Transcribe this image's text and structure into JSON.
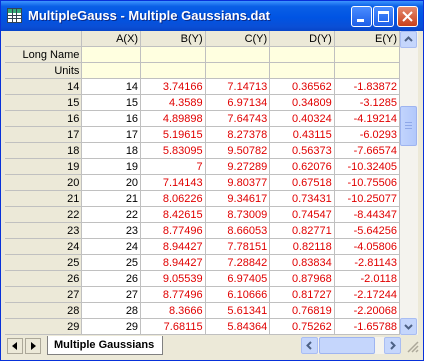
{
  "window": {
    "title": "MultipleGauss - Multiple Gaussians.dat"
  },
  "columns": [
    "A(X)",
    "B(Y)",
    "C(Y)",
    "D(Y)",
    "E(Y)"
  ],
  "meta_rows": [
    {
      "label": "Long Name",
      "values": [
        "",
        "",
        "",
        "",
        ""
      ]
    },
    {
      "label": "Units",
      "values": [
        "",
        "",
        "",
        "",
        ""
      ]
    }
  ],
  "rows": [
    {
      "label": "14",
      "values": [
        "14",
        "3.74166",
        "7.14713",
        "0.36562",
        "-1.83872"
      ]
    },
    {
      "label": "15",
      "values": [
        "15",
        "4.3589",
        "6.97134",
        "0.34809",
        "-3.1285"
      ]
    },
    {
      "label": "16",
      "values": [
        "16",
        "4.89898",
        "7.64743",
        "0.40324",
        "-4.19214"
      ]
    },
    {
      "label": "17",
      "values": [
        "17",
        "5.19615",
        "8.27378",
        "0.43115",
        "-6.0293"
      ]
    },
    {
      "label": "18",
      "values": [
        "18",
        "5.83095",
        "9.50782",
        "0.56373",
        "-7.66574"
      ]
    },
    {
      "label": "19",
      "values": [
        "19",
        "7",
        "9.27289",
        "0.62076",
        "-10.32405"
      ]
    },
    {
      "label": "20",
      "values": [
        "20",
        "7.14143",
        "9.80377",
        "0.67518",
        "-10.75506"
      ]
    },
    {
      "label": "21",
      "values": [
        "21",
        "8.06226",
        "9.34617",
        "0.73431",
        "-10.25077"
      ]
    },
    {
      "label": "22",
      "values": [
        "22",
        "8.42615",
        "8.73009",
        "0.74547",
        "-8.44347"
      ]
    },
    {
      "label": "23",
      "values": [
        "23",
        "8.77496",
        "8.66053",
        "0.82771",
        "-5.64256"
      ]
    },
    {
      "label": "24",
      "values": [
        "24",
        "8.94427",
        "7.78151",
        "0.82118",
        "-4.05806"
      ]
    },
    {
      "label": "25",
      "values": [
        "25",
        "8.94427",
        "7.28842",
        "0.83834",
        "-2.81143"
      ]
    },
    {
      "label": "26",
      "values": [
        "26",
        "9.05539",
        "6.97405",
        "0.87968",
        "-2.0118"
      ]
    },
    {
      "label": "27",
      "values": [
        "27",
        "8.77496",
        "6.10666",
        "0.81727",
        "-2.17244"
      ]
    },
    {
      "label": "28",
      "values": [
        "28",
        "8.3666",
        "5.61341",
        "0.76819",
        "-2.20068"
      ]
    },
    {
      "label": "29",
      "values": [
        "29",
        "7.68115",
        "5.84364",
        "0.75262",
        "-1.65788"
      ]
    }
  ],
  "sheet_tab": {
    "label": "Multiple Gaussians"
  },
  "icons": {
    "app": "spreadsheet-icon",
    "minimize": "minimize-icon",
    "maximize": "maximize-icon",
    "close": "close-icon"
  },
  "colors": {
    "data_red": "#e00000",
    "meta_yellow": "#ffffe0",
    "titlebar_blue": "#0054e3"
  }
}
